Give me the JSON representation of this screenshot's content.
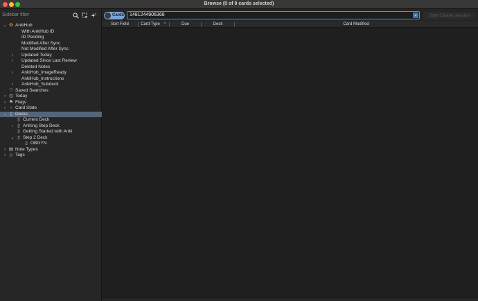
{
  "window": {
    "title": "Browse (0 of 0 cards selected)"
  },
  "sidebar": {
    "filter_placeholder": "Sidebar filter",
    "items": [
      {
        "label": "AnkiHub",
        "indent": 0,
        "chevron": "down",
        "icon": "ankihub-icon"
      },
      {
        "label": "With AnkiHub ID",
        "indent": 1,
        "chevron": "",
        "icon": ""
      },
      {
        "label": "ID Pending",
        "indent": 1,
        "chevron": "",
        "icon": ""
      },
      {
        "label": "Modified After Sync",
        "indent": 1,
        "chevron": "",
        "icon": ""
      },
      {
        "label": "Not Modified After Sync",
        "indent": 1,
        "chevron": "",
        "icon": ""
      },
      {
        "label": "Updated Today",
        "indent": 1,
        "chevron": "right",
        "icon": ""
      },
      {
        "label": "Updated Since Last Review",
        "indent": 1,
        "chevron": "right",
        "icon": ""
      },
      {
        "label": "Deleted Notes",
        "indent": 1,
        "chevron": "",
        "icon": ""
      },
      {
        "label": "AnkiHub_ImageReady",
        "indent": 1,
        "chevron": "right",
        "icon": ""
      },
      {
        "label": "AnkiHub_Instructions",
        "indent": 1,
        "chevron": "",
        "icon": ""
      },
      {
        "label": "AnkiHub_Subdeck",
        "indent": 1,
        "chevron": "right",
        "icon": ""
      },
      {
        "label": "Saved Searches",
        "indent": 0,
        "chevron": "",
        "icon": "heart-icon"
      },
      {
        "label": "Today",
        "indent": 0,
        "chevron": "right",
        "icon": "clock-icon"
      },
      {
        "label": "Flags",
        "indent": 0,
        "chevron": "right",
        "icon": "flag-icon"
      },
      {
        "label": "Card State",
        "indent": 0,
        "chevron": "right",
        "icon": "circle-icon"
      },
      {
        "label": "Decks",
        "indent": 0,
        "chevron": "down",
        "icon": "deck-icon",
        "selected": true
      },
      {
        "label": "Current Deck",
        "indent": 1,
        "chevron": "",
        "icon": "deck-icon"
      },
      {
        "label": "AnKing Step Deck",
        "indent": 1,
        "chevron": "right",
        "icon": "deck-icon"
      },
      {
        "label": "Getting Started with Anki",
        "indent": 1,
        "chevron": "",
        "icon": "deck-icon"
      },
      {
        "label": "Step 2 Deck",
        "indent": 1,
        "chevron": "down",
        "icon": "deck-icon"
      },
      {
        "label": "OBGYN",
        "indent": 2,
        "chevron": "",
        "icon": "deck-icon"
      },
      {
        "label": "Note Types",
        "indent": 0,
        "chevron": "right",
        "icon": "note-types-icon"
      },
      {
        "label": "Tags",
        "indent": 0,
        "chevron": "right",
        "icon": "tag-icon"
      }
    ]
  },
  "toolbar": {
    "toggle_label": "Cards",
    "search_value": "1481244906368",
    "obank_label": "Start Obank session"
  },
  "table": {
    "columns": [
      {
        "label": "Sort Field"
      },
      {
        "label": "Card Type",
        "sort": "asc"
      },
      {
        "label": "Due"
      },
      {
        "label": "Deck"
      },
      {
        "label": "Card Modified"
      }
    ],
    "rows": []
  }
}
